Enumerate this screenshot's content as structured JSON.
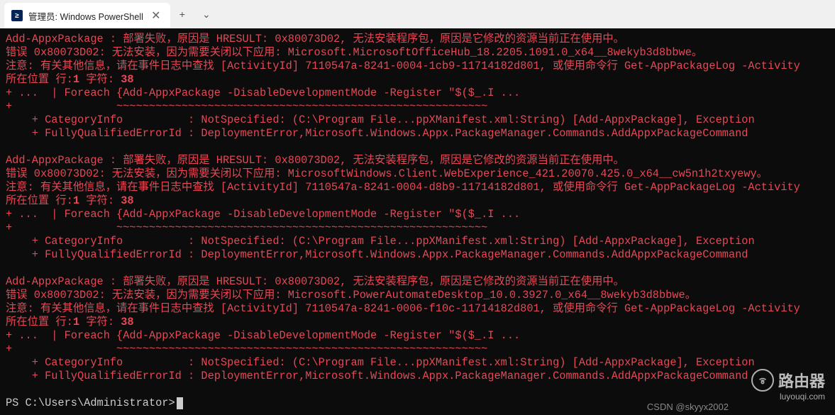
{
  "tab": {
    "title": "管理员: Windows PowerShell",
    "icon_text": "≥",
    "close_glyph": "✕",
    "add_glyph": "+",
    "drop_glyph": "⌄"
  },
  "errors": [
    {
      "header": "Add-AppxPackage : 部署失败，原因是 HRESULT: 0x80073D02, 无法安装程序包，原因是它修改的资源当前正在使用中。",
      "code_line": "错误 0x80073D02: 无法安装，因为需要关闭以下应用: Microsoft.MicrosoftOfficeHub_18.2205.1091.0_x64__8wekyb3d8bbwe。",
      "note_line": "注意: 有关其他信息，请在事件日志中查找 [ActivityId] 7110547a-8241-0004-1cb9-11714182d801, 或使用命令行 Get-AppPackageLog -Activity",
      "pos_line": "所在位置 行:1 字符: 38",
      "cmd_line": "+ ...  | Foreach {Add-AppxPackage -DisableDevelopmentMode -Register \"$($_.I ...",
      "tilde_line": "+                ~~~~~~~~~~~~~~~~~~~~~~~~~~~~~~~~~~~~~~~~~~~~~~~~~~~~~~~~~",
      "cat_line": "    + CategoryInfo          : NotSpecified: (C:\\Program File...ppXManifest.xml:String) [Add-AppxPackage], Exception",
      "fqid_line": "    + FullyQualifiedErrorId : DeploymentError,Microsoft.Windows.Appx.PackageManager.Commands.AddAppxPackageCommand"
    },
    {
      "header": "Add-AppxPackage : 部署失败，原因是 HRESULT: 0x80073D02, 无法安装程序包，原因是它修改的资源当前正在使用中。",
      "code_line": "错误 0x80073D02: 无法安装，因为需要关闭以下应用: MicrosoftWindows.Client.WebExperience_421.20070.425.0_x64__cw5n1h2txyewy。",
      "note_line": "注意: 有关其他信息，请在事件日志中查找 [ActivityId] 7110547a-8241-0004-d8b9-11714182d801, 或使用命令行 Get-AppPackageLog -Activity",
      "pos_line": "所在位置 行:1 字符: 38",
      "cmd_line": "+ ...  | Foreach {Add-AppxPackage -DisableDevelopmentMode -Register \"$($_.I ...",
      "tilde_line": "+                ~~~~~~~~~~~~~~~~~~~~~~~~~~~~~~~~~~~~~~~~~~~~~~~~~~~~~~~~~",
      "cat_line": "    + CategoryInfo          : NotSpecified: (C:\\Program File...ppXManifest.xml:String) [Add-AppxPackage], Exception",
      "fqid_line": "    + FullyQualifiedErrorId : DeploymentError,Microsoft.Windows.Appx.PackageManager.Commands.AddAppxPackageCommand"
    },
    {
      "header": "Add-AppxPackage : 部署失败，原因是 HRESULT: 0x80073D02, 无法安装程序包，原因是它修改的资源当前正在使用中。",
      "code_line": "错误 0x80073D02: 无法安装，因为需要关闭以下应用: Microsoft.PowerAutomateDesktop_10.0.3927.0_x64__8wekyb3d8bbwe。",
      "note_line": "注意: 有关其他信息，请在事件日志中查找 [ActivityId] 7110547a-8241-0006-f10c-11714182d801, 或使用命令行 Get-AppPackageLog -Activity",
      "pos_line": "所在位置 行:1 字符: 38",
      "cmd_line": "+ ...  | Foreach {Add-AppxPackage -DisableDevelopmentMode -Register \"$($_.I ...",
      "tilde_line": "+                ~~~~~~~~~~~~~~~~~~~~~~~~~~~~~~~~~~~~~~~~~~~~~~~~~~~~~~~~~",
      "cat_line": "    + CategoryInfo          : NotSpecified: (C:\\Program File...ppXManifest.xml:String) [Add-AppxPackage], Exception",
      "fqid_line": "    + FullyQualifiedErrorId : DeploymentError,Microsoft.Windows.Appx.PackageManager.Commands.AddAppxPackageCommand"
    }
  ],
  "prompt_line": "PS C:\\Users\\Administrator>",
  "watermark": {
    "router_text": "路由器",
    "router_sub": "luyouqi.com",
    "csdn": "CSDN @skyyx2002"
  }
}
